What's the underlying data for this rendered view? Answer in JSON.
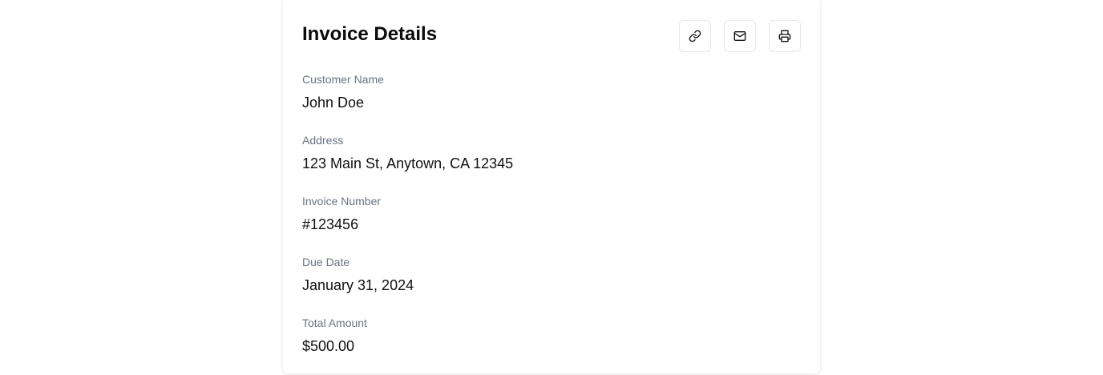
{
  "card": {
    "title": "Invoice Details",
    "actions": [
      {
        "name": "link-button",
        "icon": "link-icon"
      },
      {
        "name": "email-button",
        "icon": "mail-icon"
      },
      {
        "name": "print-button",
        "icon": "printer-icon"
      }
    ],
    "fields": [
      {
        "label": "Customer Name",
        "value": "John Doe"
      },
      {
        "label": "Address",
        "value": "123 Main St, Anytown, CA 12345"
      },
      {
        "label": "Invoice Number",
        "value": "#123456"
      },
      {
        "label": "Due Date",
        "value": "January 31, 2024"
      },
      {
        "label": "Total Amount",
        "value": "$500.00"
      }
    ]
  }
}
